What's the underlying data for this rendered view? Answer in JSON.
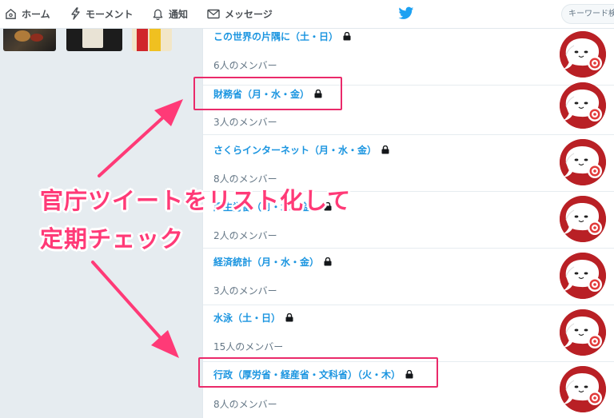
{
  "nav": {
    "home": "ホーム",
    "moments": "モーメント",
    "notifications": "通知",
    "messages": "メッセージ",
    "search_placeholder": "キーワード検索"
  },
  "lists": [
    {
      "name": "この世界の片隅に（土・日）",
      "members": "6人のメンバー",
      "private": true
    },
    {
      "name": "財務省（月・水・金）",
      "members": "3人のメンバー",
      "private": true
    },
    {
      "name": "さくらインターネット（月・水・金）",
      "members": "8人のメンバー",
      "private": true
    },
    {
      "name": "厚生労働（月・水・金）",
      "members": "2人のメンバー",
      "private": true
    },
    {
      "name": "経済統計（月・水・金）",
      "members": "3人のメンバー",
      "private": true
    },
    {
      "name": "水泳（土・日）",
      "members": "15人のメンバー",
      "private": true
    },
    {
      "name": "行政（厚労省・経産省・文科省）（火・木）",
      "members": "8人のメンバー",
      "private": true
    }
  ],
  "annotation": {
    "line1": "官庁ツイートをリスト化して",
    "line2": "定期チェック"
  },
  "colors": {
    "link": "#1b95e0",
    "annotation": "#ff3a77",
    "highlight_box": "#ea2a6a",
    "avatar_bg": "#b92025",
    "twitter_blue": "#1da1f2"
  }
}
